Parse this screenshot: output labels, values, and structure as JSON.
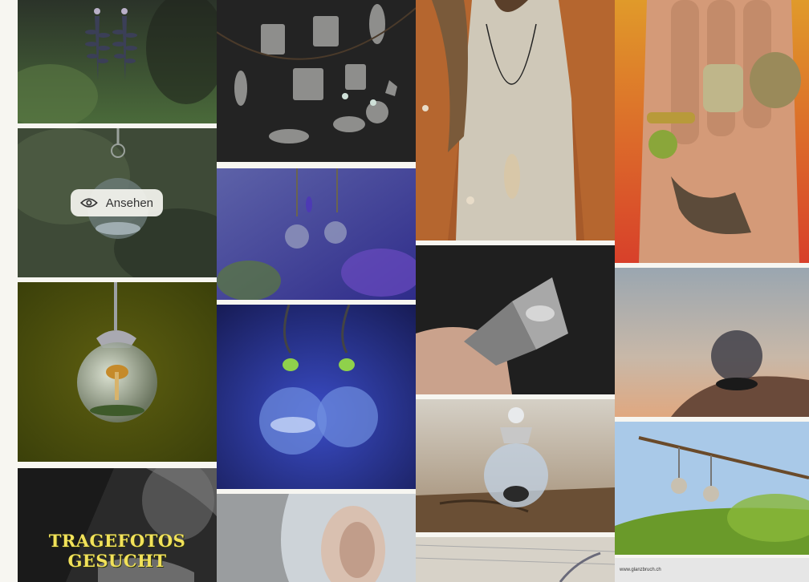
{
  "gallery": {
    "view_button_label": "Ansehen",
    "columns": [
      [
        {
          "name": "fern-earrings-photo",
          "description": "Fern leaf earrings"
        },
        {
          "name": "globe-pendant-hover-photo",
          "description": "Glass globe pendant"
        },
        {
          "name": "mushroom-globe-pendant-photo",
          "description": "Mushroom globe pendant"
        },
        {
          "name": "tragefotos-photo",
          "overlay_text": "TRAGEFOTOS GESUCHT"
        }
      ],
      [
        {
          "name": "silver-amulets-photo",
          "description": "Silver amulets"
        },
        {
          "name": "lavender-earrings-photo",
          "description": "Lavender earrings"
        },
        {
          "name": "glueck-earrings-photo",
          "description": "Glück earrings"
        },
        {
          "name": "ear-earring-photo",
          "description": "Ear with earring"
        }
      ],
      [
        {
          "name": "man-pendant-photo",
          "description": "Man wearing pendant"
        },
        {
          "name": "dream-locket-photo",
          "description": "Dream locket"
        },
        {
          "name": "mindy-globe-photo",
          "description": "Mindy globe"
        },
        {
          "name": "book-chain-photo",
          "description": "Book with chain"
        }
      ],
      [
        {
          "name": "rings-hand-photo",
          "description": "Hand with rings"
        },
        {
          "name": "glass-dome-photo",
          "description": "Glass dome ring"
        },
        {
          "name": "branch-earrings-photo",
          "description": "Earrings on branch"
        },
        {
          "name": "glanzbruch-url-photo",
          "overlay_text": "www.glanzbruch.ch"
        }
      ]
    ]
  }
}
